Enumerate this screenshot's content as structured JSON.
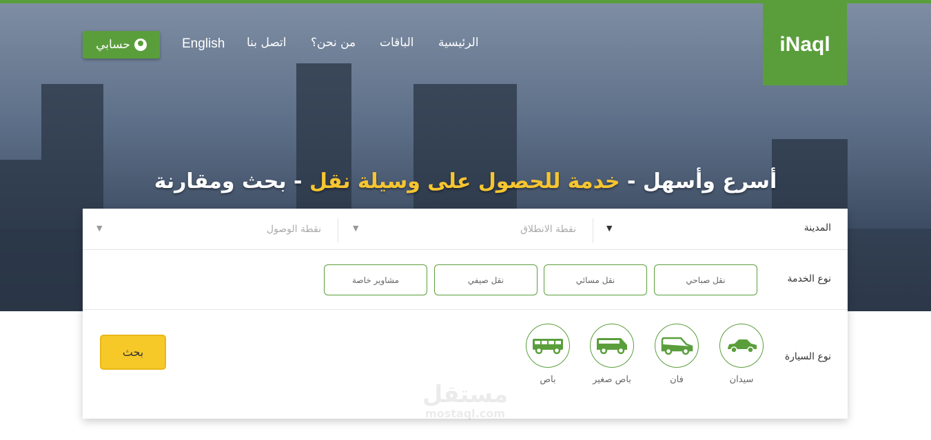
{
  "brand": {
    "logo": "iNaql",
    "color": "#5a9e3c",
    "accent": "#f6c530"
  },
  "nav": {
    "items": [
      "الرئيسية",
      "الباقات",
      "من نحن؟",
      "اتصل بنا",
      "English"
    ],
    "account": "حسابي",
    "account_icon": "user-circle-icon"
  },
  "hero": {
    "part1": "أسرع وأسهل - ",
    "part2": "خدمة للحصول على وسيلة نقل",
    "part3": " - بحث ومقارنة"
  },
  "form": {
    "city_label": "المدينة",
    "start_placeholder": "نقطة الانطلاق",
    "end_placeholder": "نقطة الوصول",
    "service_label": "نوع الخدمة",
    "services": [
      "نقل صباحي",
      "نقل مسائي",
      "نقل صيفي",
      "مشاوير خاصة"
    ],
    "vehicle_label": "نوع السيارة",
    "vehicles": [
      {
        "name": "سيدان",
        "icon": "sedan-icon"
      },
      {
        "name": "فان",
        "icon": "van-icon"
      },
      {
        "name": "باص صغير",
        "icon": "minibus-icon"
      },
      {
        "name": "باص",
        "icon": "bus-icon"
      }
    ],
    "search": "بحث"
  },
  "watermark": {
    "ar": "مستقل",
    "en": "mostaql.com"
  }
}
